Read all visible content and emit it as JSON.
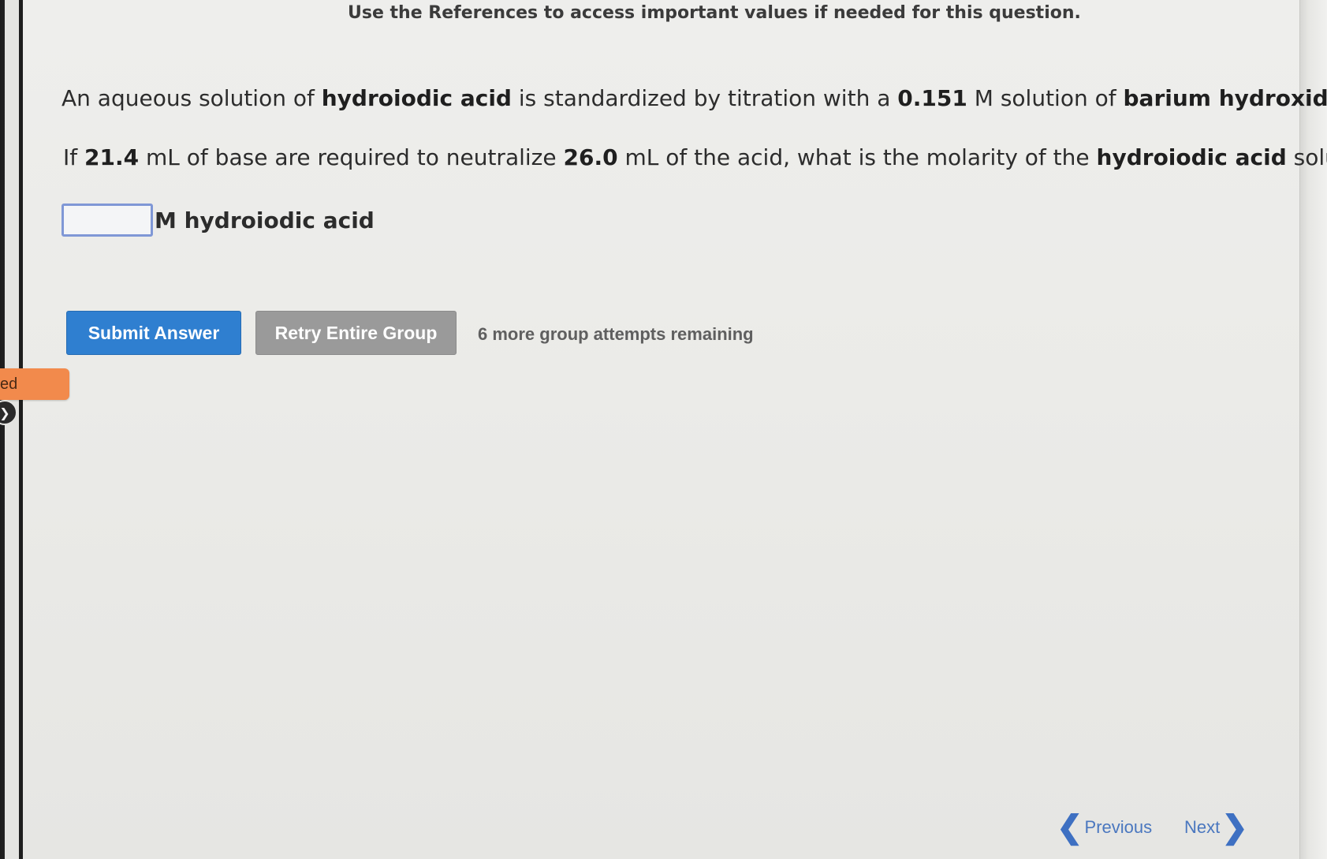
{
  "reference_note": "Use the References to access important values if needed for this question.",
  "question": {
    "line1": {
      "t1": "An aqueous solution of ",
      "b1": "hydroiodic acid",
      "t2": " is standardized by titration with a ",
      "b2": "0.151",
      "t3": " M solution of ",
      "b3": "barium hydroxide",
      "t4": "."
    },
    "line2": {
      "t1": "If ",
      "b1": "21.4",
      "t2": " mL of base are required to neutralize ",
      "b2": "26.0",
      "t3": " mL of the acid, what is the molarity of the ",
      "b3": "hydroiodic acid",
      "t4": " solution?"
    }
  },
  "answer": {
    "value": "",
    "unit_label": "M hydroiodic acid"
  },
  "buttons": {
    "submit": "Submit Answer",
    "retry": "Retry Entire Group"
  },
  "attempts_text": "6 more group attempts remaining",
  "side_tab": {
    "label": "ed"
  },
  "nav": {
    "previous": "Previous",
    "next": "Next"
  },
  "colors": {
    "submit_bg": "#2f7fd0",
    "retry_bg": "#9a9a9a",
    "side_tab_bg": "#f28a4c",
    "nav_link": "#4a77bf",
    "input_border": "#7f97d6"
  },
  "icons": {
    "previous": "chevron-left-icon",
    "next": "chevron-right-icon",
    "side": "circle-arrow-icon"
  }
}
